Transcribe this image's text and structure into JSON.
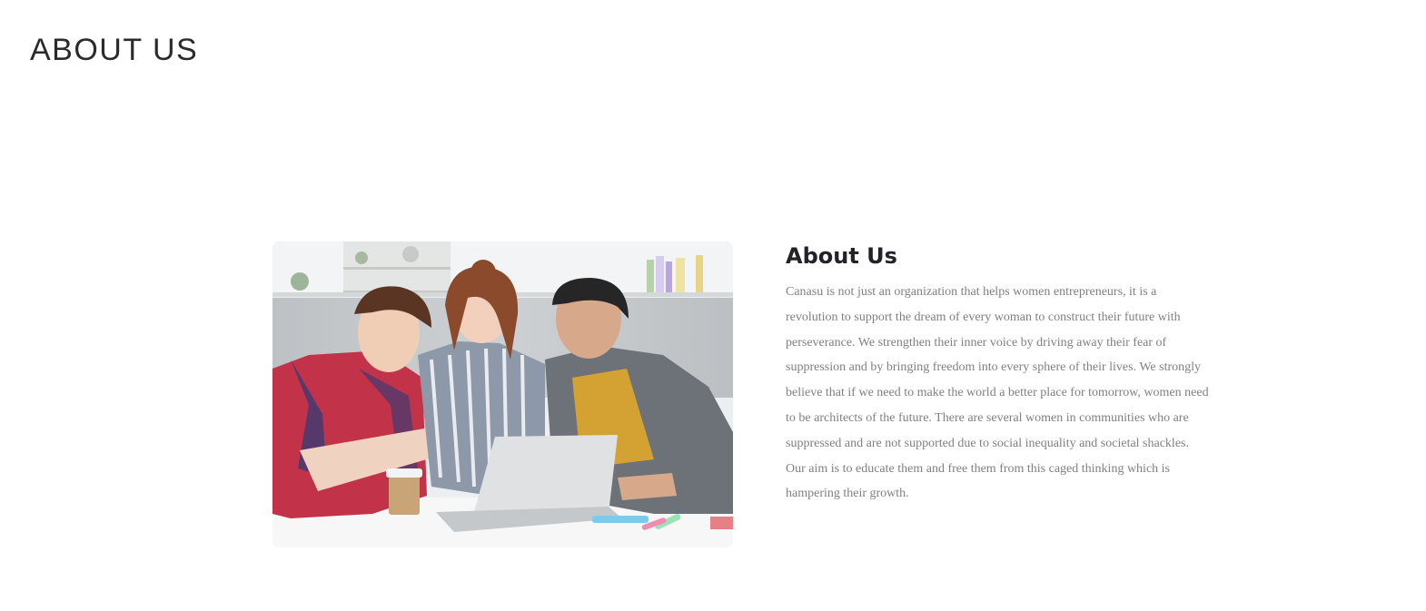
{
  "page": {
    "title": "ABOUT US"
  },
  "about": {
    "heading": "About Us",
    "body": "Canasu is not just an organization that helps women entrepreneurs, it is a revolution to support the dream of every woman to construct their future with perseverance. We strengthen their inner voice by driving away their fear of suppression and by bringing freedom into every sphere of their lives. We strongly believe that if we need to make the world a better place for tomorrow, women need to be architects of the future. There are several women in communities who are suppressed and are not supported due to social inequality and societal shackles. Our aim is to educate them and free them from this caged thinking which is hampering their growth.",
    "image": {
      "icon": "photo-three-people-laptop"
    }
  },
  "colors": {
    "title": "#2b2b2b",
    "heading": "#222228",
    "body_text": "#808080",
    "background": "#ffffff"
  }
}
